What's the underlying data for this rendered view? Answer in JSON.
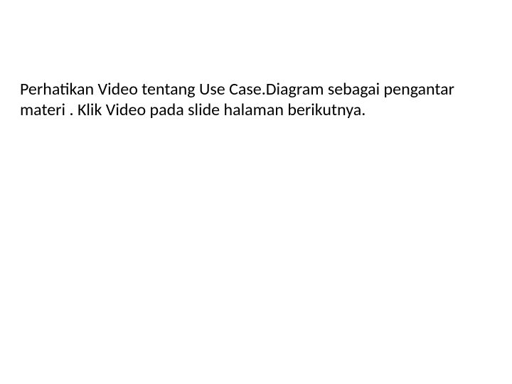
{
  "slide": {
    "body": "Perhatikan Video tentang Use Case.Diagram sebagai pengantar materi . Klik Video pada slide halaman berikutnya."
  }
}
